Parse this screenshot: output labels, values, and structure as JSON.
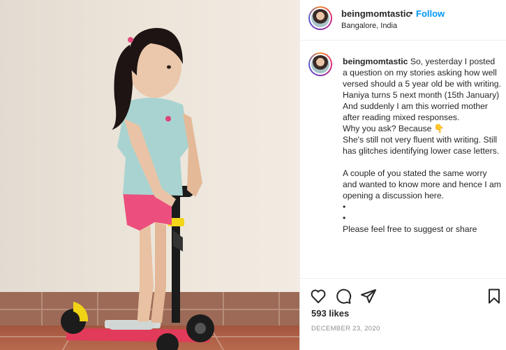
{
  "post": {
    "username": "beingmomtastic",
    "separator": "•",
    "follow_label": "Follow",
    "location": "Bangalore, India"
  },
  "caption": {
    "username": "beingmomtastic",
    "lines": [
      "So, yesterday I posted a question on my stories asking how well versed should a 5 year old be with writing.",
      "Haniya turns 5 next month (15th January)",
      "And suddenly I am this worried mother after reading mixed responses.",
      "Why you ask? Because 👇",
      "She's still not very fluent with writing. Still has glitches identifying lower case letters.",
      "",
      "A couple of you stated the same worry and wanted to know more and hence I am opening a discussion here.",
      "•",
      "•",
      "Please feel free to suggest or share"
    ]
  },
  "actions": {
    "icons": [
      "heart-icon",
      "comment-icon",
      "share-icon",
      "bookmark-icon"
    ],
    "likes": "593 likes",
    "date": "DECEMBER 23, 2020"
  },
  "colors": {
    "accent": "#0095f6",
    "text": "#262626",
    "muted": "#8e8e8e"
  }
}
